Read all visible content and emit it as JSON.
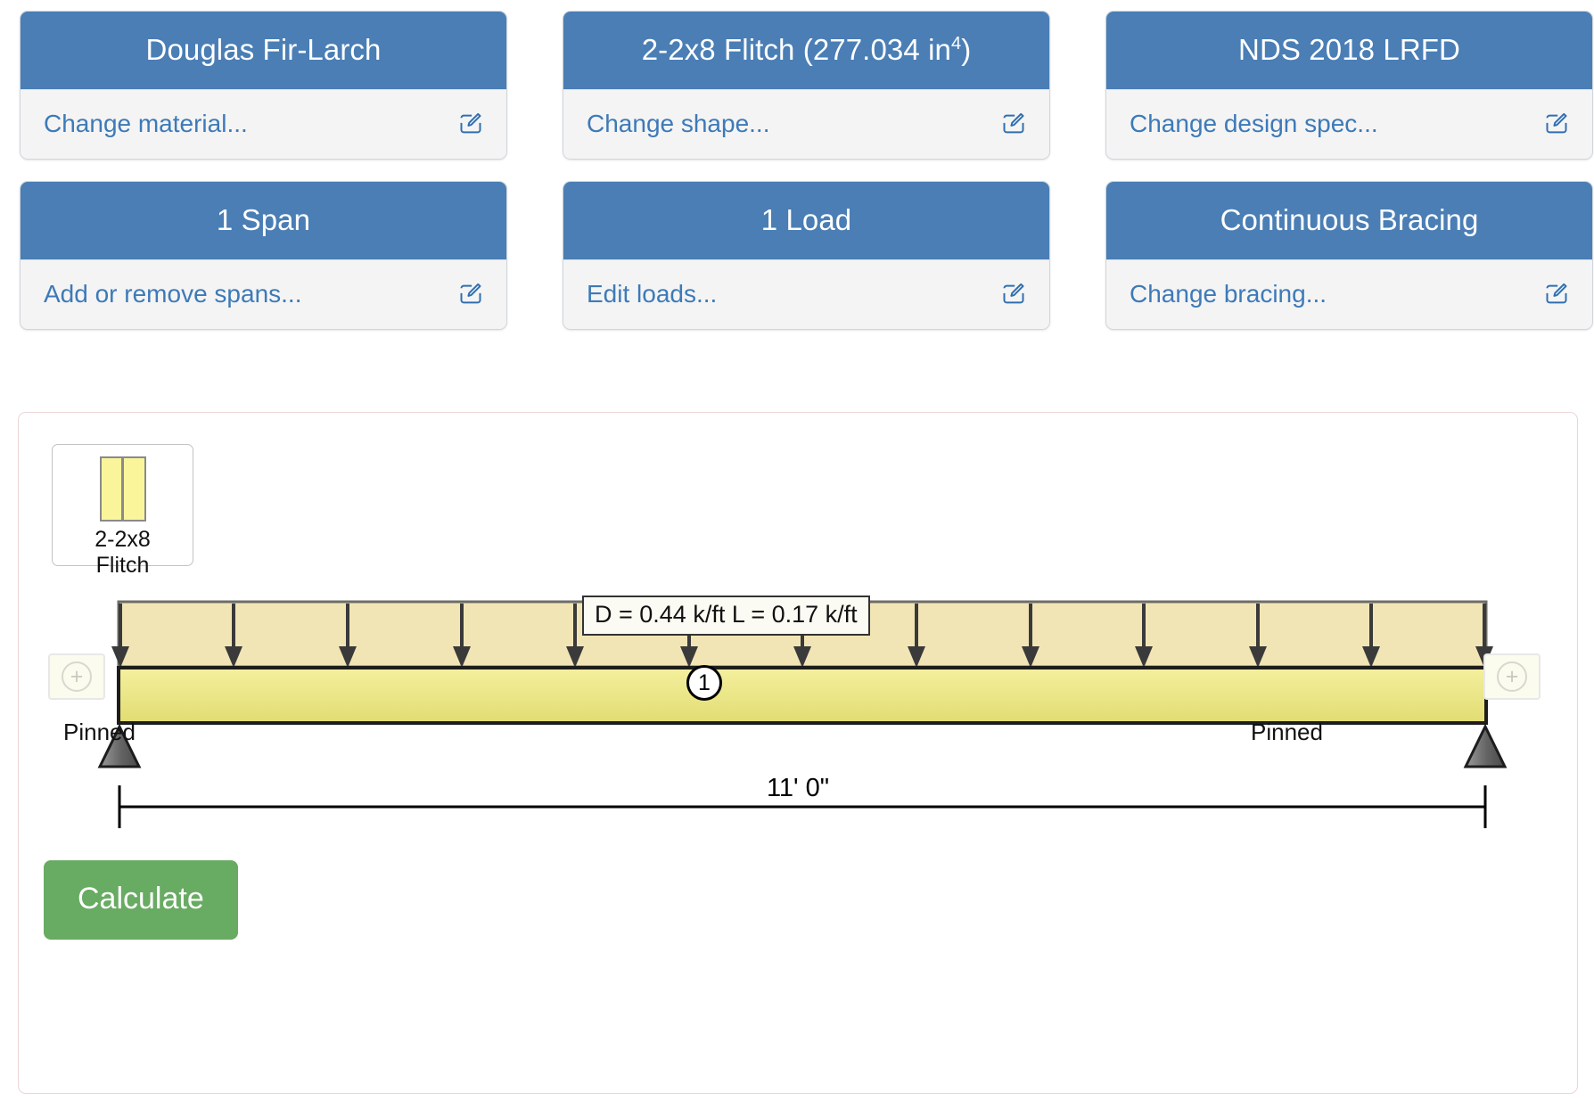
{
  "cards": [
    {
      "title": "Douglas Fir-Larch",
      "title_sup": "",
      "title_suffix": "",
      "action": "Change material...",
      "icon": "edit-icon",
      "name": "material"
    },
    {
      "title": "2-2x8 Flitch (277.034 in",
      "title_sup": "4",
      "title_suffix": ")",
      "action": "Change shape...",
      "icon": "edit-icon",
      "name": "shape"
    },
    {
      "title": "NDS 2018 LRFD",
      "title_sup": "",
      "title_suffix": "",
      "action": "Change design spec...",
      "icon": "edit-icon",
      "name": "design-spec"
    },
    {
      "title": "1 Span",
      "title_sup": "",
      "title_suffix": "",
      "action": "Add or remove spans...",
      "icon": "edit-icon",
      "name": "spans"
    },
    {
      "title": "1 Load",
      "title_sup": "",
      "title_suffix": "",
      "action": "Edit loads...",
      "icon": "edit-icon",
      "name": "loads"
    },
    {
      "title": "Continuous Bracing",
      "title_sup": "",
      "title_suffix": "",
      "action": "Change bracing...",
      "icon": "edit-icon",
      "name": "bracing"
    }
  ],
  "diagram": {
    "shape_thumb": {
      "line1": "2-2x8",
      "line2": "Flitch",
      "icon": "flitch-section-icon"
    },
    "load_tag": "D = 0.44 k/ft L = 0.17 k/ft",
    "span_number": "1",
    "support_left": "Pinned",
    "support_right": "Pinned",
    "dimension": "11' 0\"",
    "add_span_left_icon": "plus-icon",
    "add_span_right_icon": "plus-icon",
    "add_span_symbol": "+",
    "arrow_count": 13
  },
  "calculate_button": "Calculate",
  "colors": {
    "card_header": "#4a7eb5",
    "card_body": "#f4f4f4",
    "link": "#3d7ab8",
    "calculate": "#68ab62",
    "beam_fill_top": "#f2ee9a",
    "beam_fill_bottom": "#e4de78",
    "load_band": "#f2e4b4",
    "panel_border": "#ead5d8"
  }
}
